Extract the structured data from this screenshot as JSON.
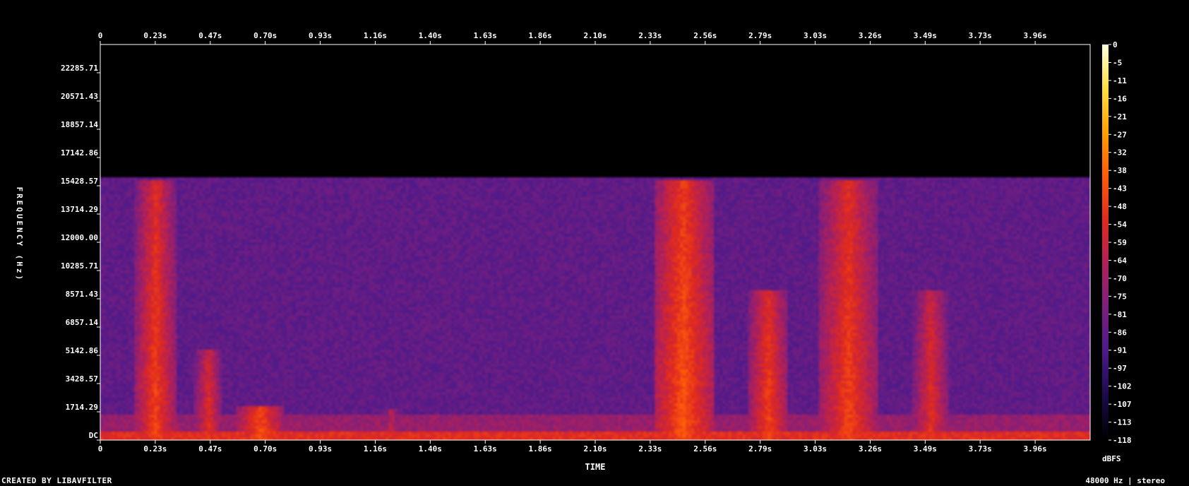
{
  "chart_data": {
    "type": "heatmap",
    "subtype": "spectrogram",
    "xlabel": "TIME",
    "ylabel": "FREQUENCY (Hz)",
    "xlim": [
      0,
      4.2
    ],
    "ylim": [
      0,
      24000
    ],
    "x_ticks": [
      "0",
      "0.23s",
      "0.47s",
      "0.70s",
      "0.93s",
      "1.16s",
      "1.40s",
      "1.63s",
      "1.86s",
      "2.10s",
      "2.33s",
      "2.56s",
      "2.79s",
      "3.03s",
      "3.26s",
      "3.49s",
      "3.73s",
      "3.96s"
    ],
    "x_tick_values": [
      0,
      0.2333,
      0.4667,
      0.7,
      0.9333,
      1.1667,
      1.4,
      1.6333,
      1.8667,
      2.1,
      2.3333,
      2.5667,
      2.8,
      3.0333,
      3.2667,
      3.5,
      3.7333,
      3.9667
    ],
    "y_ticks": [
      "DC",
      "1714.29",
      "3428.57",
      "5142.86",
      "6857.14",
      "8571.43",
      "10285.71",
      "12000.00",
      "13714.29",
      "15428.57",
      "17142.86",
      "18857.14",
      "20571.43",
      "22285.71"
    ],
    "y_tick_values": [
      0,
      1714.29,
      3428.57,
      5142.86,
      6857.14,
      8571.43,
      10285.71,
      12000.0,
      13714.29,
      15428.57,
      17142.86,
      18857.14,
      20571.43,
      22285.71
    ],
    "colorbar": {
      "label": "dBFS",
      "ticks": [
        "0",
        "-5",
        "-11",
        "-16",
        "-21",
        "-27",
        "-32",
        "-38",
        "-43",
        "-48",
        "-54",
        "-59",
        "-64",
        "-70",
        "-75",
        "-81",
        "-86",
        "-91",
        "-97",
        "-102",
        "-107",
        "-113",
        "-118"
      ],
      "range": [
        -118,
        0
      ],
      "colors": [
        "#000000",
        "#1a0a4a",
        "#4b1a8a",
        "#7a1f7f",
        "#b0205a",
        "#e02a1f",
        "#ff5a0a",
        "#ffa000",
        "#ffe040",
        "#ffffe0"
      ]
    },
    "noise_floor_db": -86,
    "cutoff_hz": 16000,
    "energy_bursts": [
      {
        "t_start": 0.15,
        "t_end": 0.32,
        "f_max_hz": 15800,
        "peak_db": -45
      },
      {
        "t_start": 0.4,
        "t_end": 0.52,
        "f_max_hz": 5500,
        "peak_db": -50
      },
      {
        "t_start": 0.58,
        "t_end": 0.78,
        "f_max_hz": 2000,
        "peak_db": -40
      },
      {
        "t_start": 1.2,
        "t_end": 1.27,
        "f_max_hz": 1800,
        "peak_db": -55
      },
      {
        "t_start": 2.35,
        "t_end": 2.6,
        "f_max_hz": 15800,
        "peak_db": -40
      },
      {
        "t_start": 2.75,
        "t_end": 2.92,
        "f_max_hz": 9000,
        "peak_db": -45
      },
      {
        "t_start": 3.05,
        "t_end": 3.3,
        "f_max_hz": 15800,
        "peak_db": -45
      },
      {
        "t_start": 3.45,
        "t_end": 3.6,
        "f_max_hz": 9000,
        "peak_db": -50
      }
    ]
  },
  "footer": {
    "created_by": "CREATED BY LIBAVFILTER",
    "audio_info": "48000 Hz | stereo"
  }
}
